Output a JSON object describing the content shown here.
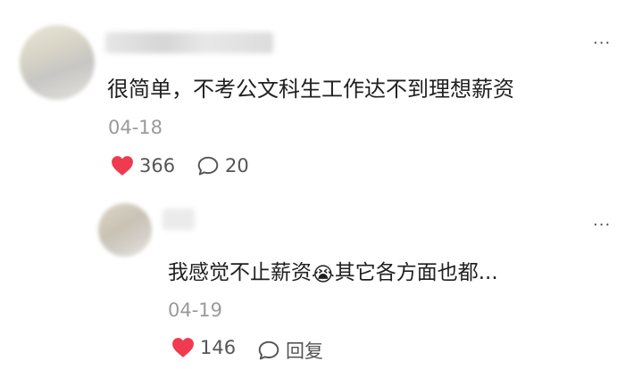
{
  "comments": [
    {
      "text": "很简单，不考公文科生工作达不到理想薪资",
      "date": "04-18",
      "likes": "366",
      "replies": "20",
      "more": "···"
    },
    {
      "text_before": "我感觉不止薪资",
      "emoji": "😭",
      "text_after": "其它各方面也都...",
      "date": "04-19",
      "likes": "146",
      "reply_label": "回复",
      "more": "···"
    }
  ],
  "colors": {
    "like": "#ef3b4f",
    "date": "#9a9a9a",
    "text": "#1f1f1f",
    "action": "#555555"
  },
  "icons": {
    "like": "heart-icon",
    "reply": "speech-bubble-icon",
    "more": "more-dots-icon"
  }
}
